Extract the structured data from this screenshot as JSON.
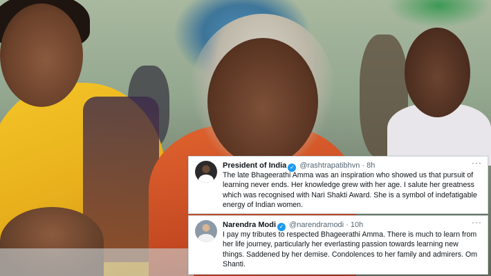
{
  "tweets": [
    {
      "name": "President of India",
      "handle": "@rashtrapatibhvn",
      "separator": "·",
      "time": "8h",
      "verified_mark": "✓",
      "more": "···",
      "text": "The late Bhageerathi Amma was an inspiration who showed us that pursuit of learning never ends. Her knowledge grew with her age. I salute her greatness which was recognised with Nari Shakti Award. She is a symbol of indefatigable energy of Indian women."
    },
    {
      "name": "Narendra Modi",
      "handle": "@narendramodi",
      "separator": "·",
      "time": "10h",
      "verified_mark": "✓",
      "more": "···",
      "text": "I pay my tributes to respected Bhageerathi Amma. There is much to learn from her life journey, particularly her everlasting passion towards learning new things. Saddened by her demise. Condolences to her family and admirers. Om Shanti."
    }
  ],
  "colors": {
    "verified": "#1d9bf0",
    "text": "#0f1419",
    "secondary": "#536471",
    "saree_yellow": "#f4c628",
    "saree_orange": "#e0632f"
  },
  "icons": [
    "verified-badge-icon",
    "more-options-icon"
  ]
}
